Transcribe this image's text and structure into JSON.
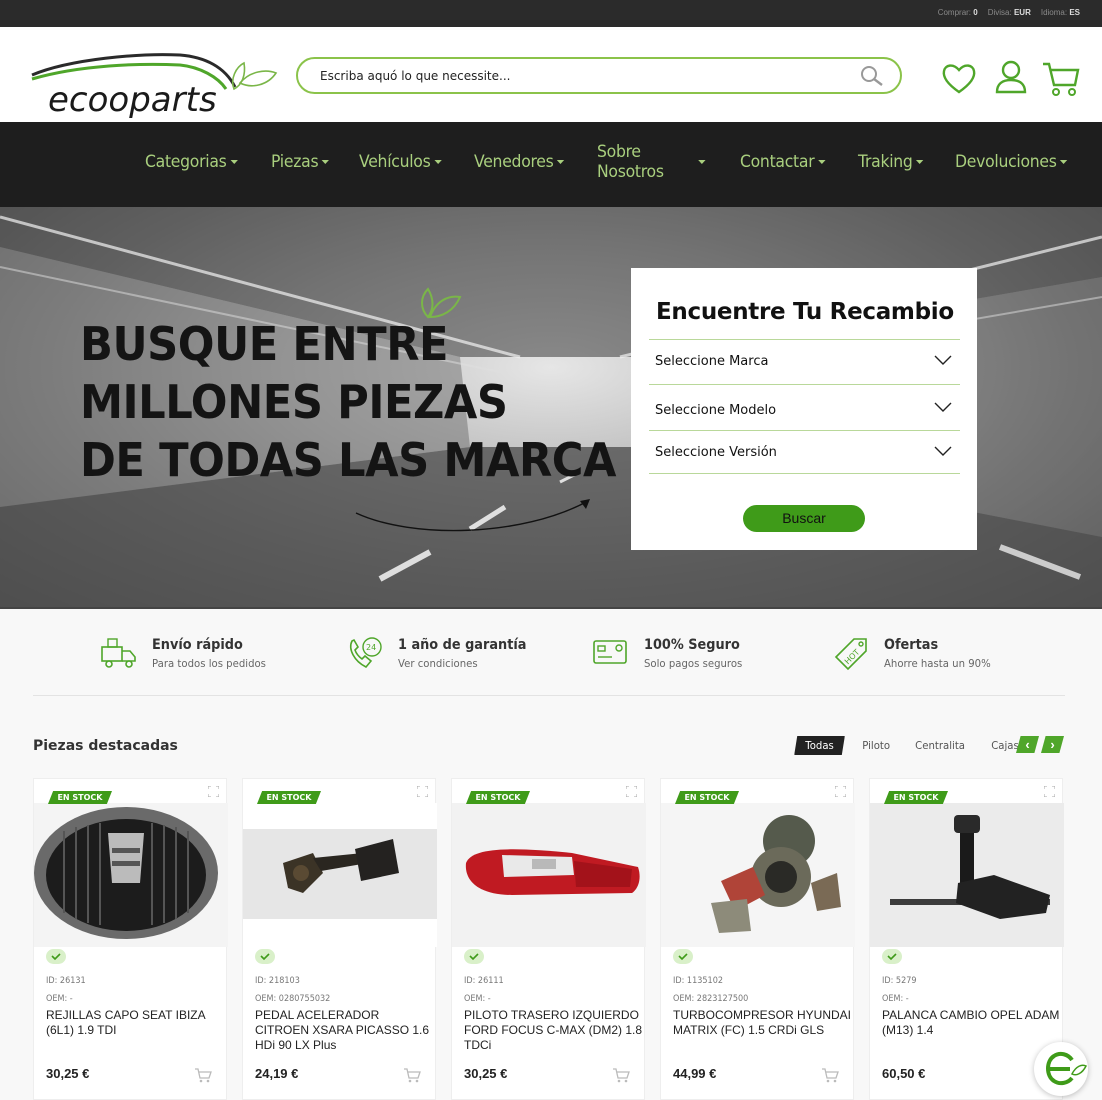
{
  "topbar": {
    "comprar_label": "Comprar:",
    "comprar_value": "0",
    "divisa_label": "Divisa:",
    "divisa_value": "EUR",
    "idioma_label": "Idioma:",
    "idioma_value": "ES"
  },
  "header": {
    "logo_text": "ecooparts",
    "search_placeholder": "Escriba aquó lo que necessite...",
    "icons": [
      "heart-icon",
      "user-icon",
      "cart-icon"
    ]
  },
  "nav": {
    "items": [
      "Categorias",
      "Piezas",
      "Vehículos",
      "Venedores",
      "Sobre Nosotros",
      "Contactar",
      "Traking",
      "Devoluciones"
    ]
  },
  "hero": {
    "title_lines": [
      "BUSQUE ENTRE",
      "MILLONES PIEZAS",
      "DE TODAS LAS MARCA"
    ],
    "finder": {
      "title": "Encuentre Tu Recambio",
      "selects": [
        "Seleccione Marca",
        "Seleccione Modelo",
        "Seleccione Versión"
      ],
      "button": "Buscar"
    }
  },
  "features": [
    {
      "title": "Envío rápido",
      "subtitle": "Para todos los pedidos",
      "icon": "truck-icon"
    },
    {
      "title": "1 año de garantía",
      "subtitle": "Ver condiciones",
      "icon": "phone-24-icon"
    },
    {
      "title": "100% Seguro",
      "subtitle": "Solo pagos seguros",
      "icon": "card-icon"
    },
    {
      "title": "Ofertas",
      "subtitle": "Ahorre hasta un 90%",
      "icon": "hot-tag-icon"
    }
  ],
  "featured": {
    "title": "Piezas destacadas",
    "tabs": [
      "Todas",
      "Piloto",
      "Centralita",
      "Cajas"
    ],
    "stock_label": "EN STOCK",
    "products": [
      {
        "id": "ID: 26131",
        "oem": "OEM: -",
        "name": "REJILLAS CAPO SEAT IBIZA (6L1) 1.9 TDI",
        "price": "30,25 €"
      },
      {
        "id": "ID: 218103",
        "oem": "OEM: 0280755032",
        "name": "PEDAL ACELERADOR CITROEN XSARA PICASSO 1.6 HDi 90 LX Plus",
        "price": "24,19 €"
      },
      {
        "id": "ID: 26111",
        "oem": "OEM: -",
        "name": "PILOTO TRASERO IZQUIERDO FORD FOCUS C-MAX (DM2) 1.8 TDCi",
        "price": "30,25 €"
      },
      {
        "id": "ID: 1135102",
        "oem": "OEM: 2823127500",
        "name": "TURBOCOMPRESOR HYUNDAI MATRIX (FC) 1.5 CRDi GLS",
        "price": "44,99 €"
      },
      {
        "id": "ID: 5279",
        "oem": "OEM: -",
        "name": "PALANCA CAMBIO OPEL ADAM (M13) 1.4",
        "price": "60,50 €"
      }
    ]
  },
  "colors": {
    "accent": "#8bc34a",
    "button": "#3f9b19",
    "nav_bg": "#1e1e1e",
    "nav_text": "#a9cf7e"
  }
}
